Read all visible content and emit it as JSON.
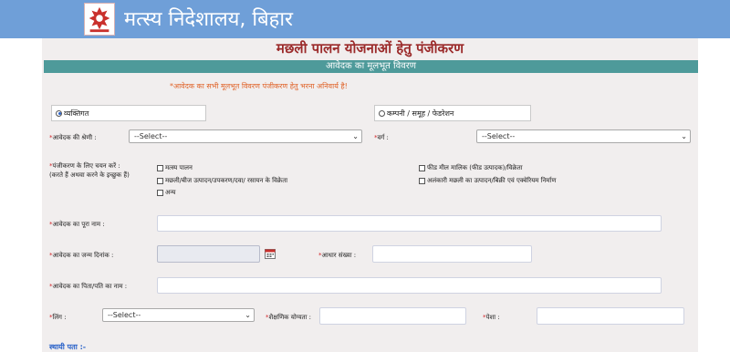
{
  "header": {
    "title": "मत्स्य निदेशालय, बिहार"
  },
  "page": {
    "title": "मछली पालन योजनाओं हेतु पंजीकरण"
  },
  "section": {
    "title": "आवेदक का मूलभूत विवरण"
  },
  "note": "*आवेदक का सभी मूलभूत विवरण पंजीकरण हेतु भरना अनिवार्य है!",
  "applicant_type": {
    "individual": "व्यक्तिगत",
    "company": "कम्पनी / समूह / फेडरेशन",
    "selected": "individual"
  },
  "category": {
    "label": "आवेदक की श्रेणी :",
    "value": "--Select--"
  },
  "varg": {
    "label": "वर्ग :",
    "value": "--Select--"
  },
  "interest": {
    "label_line1": "पंजीकरण के लिए चयन करें :",
    "label_line2": "(करते हैं अथवा करने के इच्छुक हैं)",
    "options": [
      "मत्स्य पालन",
      "मछली/बीज उत्पादन/उपकरण/दवा/ रसायन के विक्रेता",
      "अन्य",
      "फीड मील मालिक (फीड उत्पादक)/विक्रेता",
      "अलंकारी मछली का उत्पादन/बिक्री एवं एक्वेरियम निर्माण"
    ]
  },
  "full_name": {
    "label": "आवेदक का पूरा नाम :",
    "value": ""
  },
  "dob": {
    "label": "आवेदक का जन्म दिनांक :",
    "value": ""
  },
  "aadhaar": {
    "label": "आधार संख्या :",
    "value": ""
  },
  "father_name": {
    "label": "आवेदक का पिता/पति का नाम :",
    "value": ""
  },
  "gender": {
    "label": "लिंग :",
    "value": "--Select--"
  },
  "education": {
    "label": "शैक्षणिक योग्यता :",
    "value": ""
  },
  "occupation": {
    "label": "पेशा :",
    "value": ""
  },
  "permanent_address": {
    "label": "स्थायी पता :-"
  },
  "colors": {
    "header": "#6f9fd8",
    "section_bar": "#4e9a9a",
    "title": "#9b2a2a",
    "note": "#e0642a",
    "required": "#d2262a"
  }
}
